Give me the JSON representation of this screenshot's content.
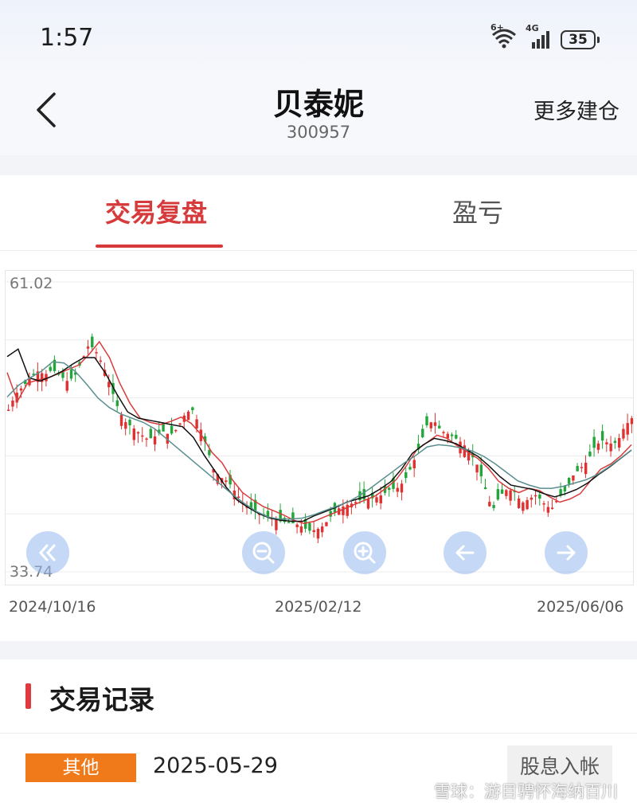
{
  "status_bar": {
    "time": "1:57",
    "wifi_label": "6+",
    "network": "4G",
    "battery": "35"
  },
  "header": {
    "title": "贝泰妮",
    "code": "300957",
    "more_label": "更多建仓",
    "back_icon": "chevron-left-icon"
  },
  "tabs": [
    {
      "label": "交易复盘",
      "active": true
    },
    {
      "label": "盈亏",
      "active": false
    }
  ],
  "chart": {
    "y_max_label": "61.02",
    "y_min_label": "33.74",
    "x_labels": [
      "2024/10/16",
      "2025/02/12",
      "2025/06/06"
    ],
    "controls": [
      "rewind-icon",
      "zoom-out-icon",
      "zoom-in-icon",
      "arrow-left-icon",
      "arrow-right-icon"
    ],
    "up_color": "#e03030",
    "down_color": "#22a53a"
  },
  "chart_data": {
    "type": "candlestick",
    "ylim": [
      33.74,
      61.02
    ],
    "gridlines": true,
    "series": [
      {
        "type": "candlestick",
        "values": [
          49.0,
          50.5,
          51.2,
          52.0,
          52.6,
          52.3,
          52.8,
          52.2,
          51.7,
          52.1,
          53.6,
          55.2,
          54.4,
          53.0,
          51.0,
          49.0,
          47.8,
          47.3,
          46.7,
          46.2,
          46.5,
          47.0,
          46.6,
          47.2,
          48.5,
          49.1,
          47.6,
          45.6,
          43.3,
          42.6,
          42.2,
          41.2,
          40.2,
          39.7,
          39.3,
          39.0,
          38.8,
          38.5,
          38.4,
          38.3,
          38.0,
          37.6,
          37.7,
          38.1,
          39.0,
          39.7,
          40.0,
          40.2,
          40.5,
          40.6,
          40.7,
          41.0,
          41.5,
          41.6,
          42.3,
          43.7,
          45.4,
          47.5,
          48.0,
          47.0,
          46.7,
          46.3,
          45.8,
          44.9,
          43.7,
          41.6,
          39.5,
          40.9,
          41.5,
          41.3,
          40.2,
          40.6,
          41.0,
          40.2,
          39.6,
          40.7,
          41.4,
          42.8,
          43.5,
          44.2,
          45.6,
          46.1,
          45.8,
          45.9,
          47.4,
          48.2
        ]
      },
      {
        "type": "line",
        "values": [
          52.5,
          49.8,
          51.5,
          51.8,
          52.0,
          52.4,
          52.8,
          53.2,
          54.2,
          55.4,
          53.9,
          51.5,
          49.6,
          48.2,
          47.8,
          47.6,
          47.9,
          48.3,
          47.7,
          46.6,
          45.0,
          44.0,
          42.4,
          41.2,
          40.5,
          39.9,
          39.5,
          39.1,
          38.6,
          38.3,
          38.5,
          38.9,
          39.3,
          39.7,
          40.1,
          40.5,
          40.9,
          41.6,
          42.4,
          43.7,
          45.2,
          45.9,
          46.6,
          46.3,
          45.6,
          45.0,
          44.4,
          43.5,
          42.3,
          41.6,
          41.2,
          41.6,
          41.4,
          40.8,
          40.3,
          40.6,
          41.1,
          42.3,
          43.4,
          43.9,
          44.7,
          45.7
        ]
      },
      {
        "type": "line",
        "values": [
          54.0,
          54.7,
          52.0,
          51.7,
          52.1,
          52.6,
          53.3,
          53.9,
          53.9,
          52.4,
          50.5,
          48.8,
          48.2,
          48.0,
          47.8,
          47.6,
          47.4,
          46.4,
          44.7,
          43.2,
          41.7,
          40.5,
          39.8,
          39.2,
          38.8,
          38.6,
          38.5,
          38.5,
          39.0,
          39.4,
          39.8,
          40.3,
          40.6,
          40.9,
          41.5,
          42.2,
          43.4,
          44.9,
          45.7,
          46.3,
          46.1,
          45.8,
          45.2,
          44.6,
          43.7,
          42.7,
          41.9,
          41.7,
          41.5,
          41.1,
          40.8,
          41.1,
          41.5,
          42.1,
          42.9,
          43.6,
          44.4,
          45.2
        ]
      },
      {
        "type": "line",
        "values": [
          50.2,
          51.3,
          52.0,
          52.6,
          53.5,
          53.4,
          52.6,
          51.4,
          50.1,
          49.2,
          48.6,
          48.2,
          47.8,
          47.2,
          46.3,
          45.4,
          44.5,
          43.6,
          42.7,
          41.8,
          40.9,
          40.1,
          39.4,
          38.9,
          38.7,
          38.7,
          38.8,
          39.1,
          39.5,
          39.9,
          40.3,
          40.9,
          41.6,
          42.4,
          43.2,
          44.0,
          44.7,
          45.5,
          45.7,
          45.6,
          45.4,
          45.1,
          44.6,
          43.9,
          43.1,
          42.3,
          41.9,
          41.6,
          41.6,
          41.8,
          42.1,
          42.4,
          42.9,
          43.6,
          44.4,
          45.2
        ]
      }
    ],
    "x_ticks": [
      "2024/10/16",
      "2025/02/12",
      "2025/06/06"
    ]
  },
  "record": {
    "section_title": "交易记录",
    "rows": [
      {
        "badge": "其他",
        "date": "2025-05-29",
        "type": "股息入帐"
      }
    ],
    "watermark": "雪球：游目骋怀海纳百川"
  }
}
